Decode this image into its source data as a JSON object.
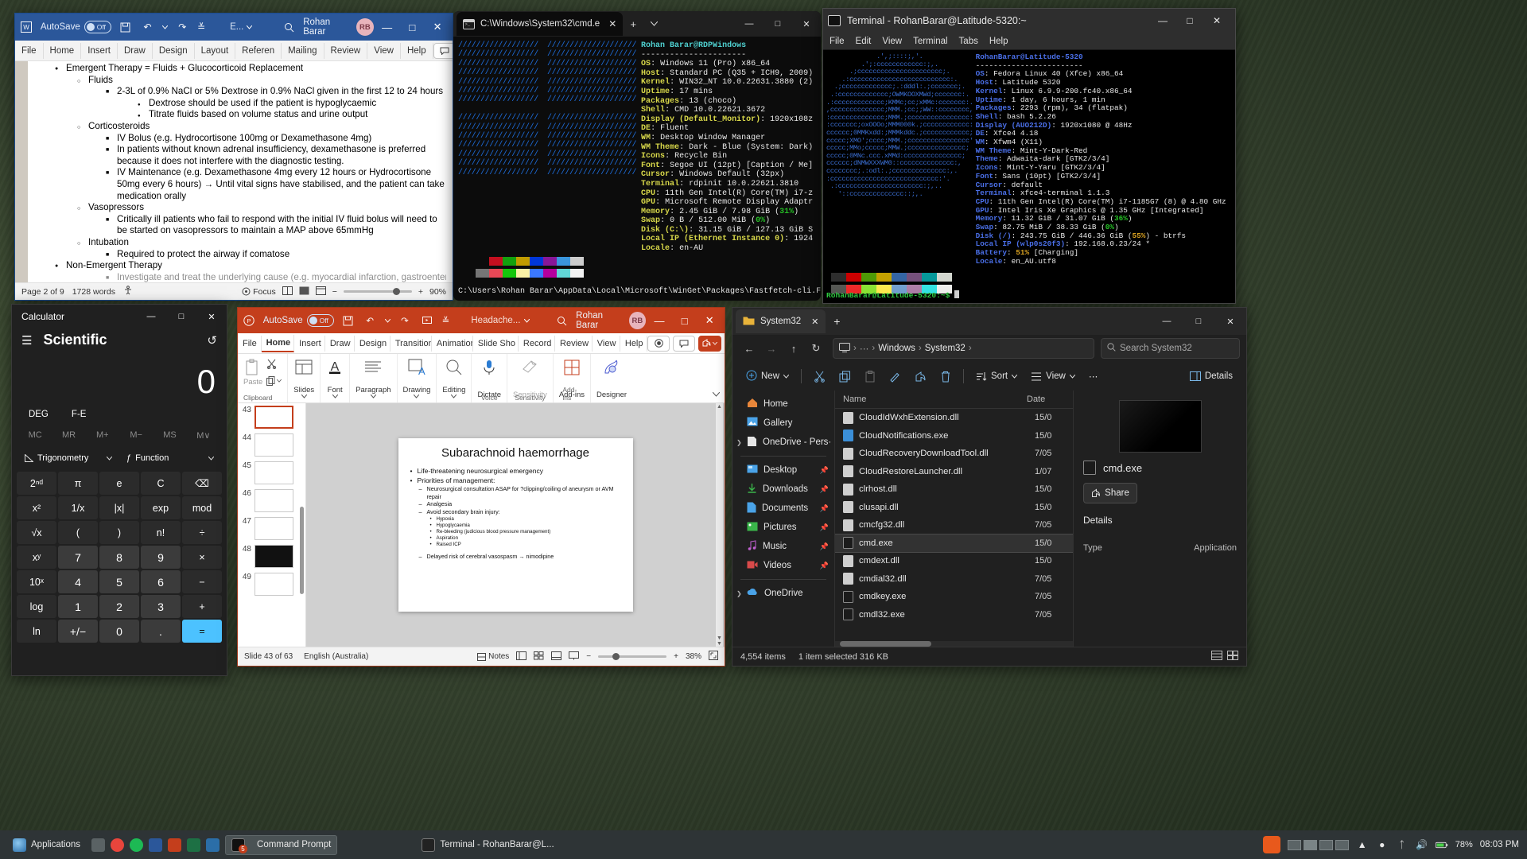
{
  "word": {
    "title_autosave": "AutoSave",
    "autosave_state": "Off",
    "filename_short": "E...",
    "user": "Rohan Barar",
    "avatar_initials": "RB",
    "tabs": [
      "File",
      "Home",
      "Insert",
      "Draw",
      "Design",
      "Layout",
      "Referen",
      "Mailing",
      "Review",
      "View",
      "Help"
    ],
    "document_lines": [
      {
        "level": 1,
        "text": "Emergent Therapy = Fluids + Glucocorticoid Replacement"
      },
      {
        "level": 2,
        "text": "Fluids"
      },
      {
        "level": 3,
        "text": "2-3L of 0.9% NaCl or 5% Dextrose in 0.9% NaCl given in the first 12 to 24 hours"
      },
      {
        "level": 4,
        "text": "Dextrose should be used if the patient is hypoglycaemic"
      },
      {
        "level": 4,
        "text": "Titrate fluids based on volume status and urine output"
      },
      {
        "level": 2,
        "text": "Corticosteroids"
      },
      {
        "level": 3,
        "text": "IV Bolus (e.g. Hydrocortisone 100mg or Dexamethasone 4mg)"
      },
      {
        "level": 3,
        "text": "In patients without known adrenal insufficiency, dexamethasone is preferred because it does not interfere with the diagnostic testing."
      },
      {
        "level": 3,
        "text": "IV Maintenance (e.g. Dexamethasone 4mg every 12 hours or Hydrocortisone 50mg every 6 hours) → Until vital signs have stabilised, and the patient can take medication orally"
      },
      {
        "level": 2,
        "text": "Vasopressors"
      },
      {
        "level": 3,
        "text": "Critically ill patients who fail to respond with the initial IV fluid bolus will need to be started on vasopressors to maintain a MAP above 65mmHg"
      },
      {
        "level": 2,
        "text": "Intubation"
      },
      {
        "level": 3,
        "text": "Required to protect the airway if comatose"
      },
      {
        "level": 1,
        "text": "Non-Emergent Therapy"
      },
      {
        "level": 3,
        "text": "Investigate and treat the underlying cause (e.g. myocardial infarction, gastroenteritis, acute"
      }
    ],
    "status": {
      "page": "Page 2 of 9",
      "words": "1728 words",
      "focus": "Focus",
      "zoom": "90%"
    }
  },
  "cmd": {
    "tab_title": "C:\\Windows\\System32\\cmd.e",
    "fastfetch": {
      "header": "Rohan Barar@RDPWindows",
      "divider": "----------------------",
      "rows": [
        {
          "k": "OS",
          "v": "Windows 11 (Pro) x86_64"
        },
        {
          "k": "Host",
          "v": "Standard PC (Q35 + ICH9, 2009)"
        },
        {
          "k": "Kernel",
          "v": "WIN32_NT 10.0.22631.3880 (2)"
        },
        {
          "k": "Uptime",
          "v": "17 mins"
        },
        {
          "k": "Packages",
          "v": "13 (choco)"
        },
        {
          "k": "Shell",
          "v": "CMD 10.0.22621.3672"
        },
        {
          "k": "Display (Default_Monitor)",
          "v": "1920x108z"
        },
        {
          "k": "DE",
          "v": "Fluent"
        },
        {
          "k": "WM",
          "v": "Desktop Window Manager"
        },
        {
          "k": "WM Theme",
          "v": "Dark - Blue (System: Dark)"
        },
        {
          "k": "Icons",
          "v": "Recycle Bin"
        },
        {
          "k": "Font",
          "v": "Segoe UI (12pt) [Caption / Me]"
        },
        {
          "k": "Cursor",
          "v": "Windows Default (32px)"
        },
        {
          "k": "Terminal",
          "v": "rdpinit 10.0.22621.3810"
        },
        {
          "k": "CPU",
          "v": "11th Gen Intel(R) Core(TM) i7-z"
        },
        {
          "k": "GPU",
          "v": "Microsoft Remote Display Adaptr"
        },
        {
          "k": "Memory",
          "v": "2.45 GiB / 7.98 GiB (31%)",
          "pct": "31%",
          "pct_color": "green"
        },
        {
          "k": "Swap",
          "v": "0 B / 512.00 MiB (0%)",
          "pct": "0%",
          "pct_color": "green"
        },
        {
          "k": "Disk (C:\\)",
          "v": "31.15 GiB / 127.13 GiB S"
        },
        {
          "k": "Local IP (Ethernet Instance 0)",
          "v": "1924"
        },
        {
          "k": "Locale",
          "v": "en-AU"
        }
      ]
    },
    "prompt": "C:\\Users\\Rohan Barar\\AppData\\Local\\Microsoft\\WinGet\\Packages\\Fastfetch-cli.F"
  },
  "linux": {
    "title": "Terminal - RohanBarar@Latitude-5320:~",
    "menu": [
      "File",
      "Edit",
      "View",
      "Terminal",
      "Tabs",
      "Help"
    ],
    "fastfetch": {
      "header": "RohanBarar@Latitude-5320",
      "divider": "------------------------",
      "rows": [
        {
          "k": "OS",
          "v": "Fedora Linux 40 (Xfce) x86_64"
        },
        {
          "k": "Host",
          "v": "Latitude 5320"
        },
        {
          "k": "Kernel",
          "v": "Linux 6.9.9-200.fc40.x86_64"
        },
        {
          "k": "Uptime",
          "v": "1 day, 6 hours, 1 min"
        },
        {
          "k": "Packages",
          "v": "2293 (rpm), 34 (flatpak)"
        },
        {
          "k": "Shell",
          "v": "bash 5.2.26"
        },
        {
          "k": "Display (AUO212D)",
          "v": "1920x1080 @ 48Hz"
        },
        {
          "k": "DE",
          "v": "Xfce4 4.18"
        },
        {
          "k": "WM",
          "v": "Xfwm4 (X11)"
        },
        {
          "k": "WM Theme",
          "v": "Mint-Y-Dark-Red"
        },
        {
          "k": "Theme",
          "v": "Adwaita-dark [GTK2/3/4]"
        },
        {
          "k": "Icons",
          "v": "Mint-Y-Yaru [GTK2/3/4]"
        },
        {
          "k": "Font",
          "v": "Sans (10pt) [GTK2/3/4]"
        },
        {
          "k": "Cursor",
          "v": "default"
        },
        {
          "k": "Terminal",
          "v": "xfce4-terminal 1.1.3"
        },
        {
          "k": "CPU",
          "v": "11th Gen Intel(R) Core(TM) i7-1185G7 (8) @ 4.80 GHz"
        },
        {
          "k": "GPU",
          "v": "Intel Iris Xe Graphics @ 1.35 GHz [Integrated]"
        },
        {
          "k": "Memory",
          "v": "11.32 GiB / 31.07 GiB (36%)",
          "pct": "36%",
          "pct_color": "green"
        },
        {
          "k": "Swap",
          "v": "82.75 MiB / 38.33 GiB (0%)",
          "pct": "0%",
          "pct_color": "green"
        },
        {
          "k": "Disk (/)",
          "v": "243.75 GiB / 446.36 GiB (55%) - btrfs",
          "pct": "55%",
          "pct_color": "orange"
        },
        {
          "k": "Local IP (wlp0s20f3)",
          "v": "192.168.0.23/24 *"
        },
        {
          "k": "Battery",
          "v": "51% [Charging]",
          "pct": "51%",
          "pct_color": "orange"
        },
        {
          "k": "Locale",
          "v": "en_AU.utf8"
        }
      ]
    },
    "prompt": "RohanBarar@Latitude-5320:~$"
  },
  "calculator": {
    "title": "Calculator",
    "mode": "Scientific",
    "display": "0",
    "angle_mode": "DEG",
    "fe_mode": "F-E",
    "memory": [
      "MC",
      "MR",
      "M+",
      "M−",
      "MS",
      "M∨"
    ],
    "dropdowns": [
      "Trigonometry",
      "Function"
    ],
    "keys": [
      "2ⁿᵈ",
      "π",
      "e",
      "C",
      "⌫",
      "x²",
      "1/x",
      "|x|",
      "exp",
      "mod",
      "√x",
      "(",
      ")",
      "n!",
      "÷",
      "xʸ",
      "7",
      "8",
      "9",
      "×",
      "10ˣ",
      "4",
      "5",
      "6",
      "−",
      "log",
      "1",
      "2",
      "3",
      "+",
      "ln",
      "+/−",
      "0",
      ".",
      "="
    ]
  },
  "powerpoint": {
    "autosave": "AutoSave",
    "autosave_state": "Off",
    "filename_short": "Headache...",
    "user": "Rohan Barar",
    "avatar_initials": "RB",
    "tabs": [
      "File",
      "Home",
      "Insert",
      "Draw",
      "Design",
      "Transition",
      "Animation",
      "Slide Sho",
      "Record",
      "Review",
      "View",
      "Help"
    ],
    "ribbon_groups": [
      {
        "label": "Paste",
        "group": "Clipboard"
      },
      {
        "label": "Slides",
        "group": ""
      },
      {
        "label": "Font",
        "group": ""
      },
      {
        "label": "Paragraph",
        "group": ""
      },
      {
        "label": "Drawing",
        "group": ""
      },
      {
        "label": "Editing",
        "group": ""
      },
      {
        "label": "Dictate",
        "group": "Voice"
      },
      {
        "label": "Sensitivity",
        "group": "Sensitivity"
      },
      {
        "label": "Add-ins",
        "group": "Add-ins"
      },
      {
        "label": "Designer",
        "group": ""
      }
    ],
    "thumbnails": [
      "43",
      "44",
      "45",
      "46",
      "47",
      "48",
      "49"
    ],
    "selected_thumb": "43",
    "slide": {
      "title": "Subarachnoid haemorrhage",
      "bullets": [
        {
          "level": 1,
          "text": "Life-threatening neurosurgical emergency"
        },
        {
          "level": 1,
          "text": "Priorities of management:"
        },
        {
          "level": 2,
          "text": "Neurosurgical consultation ASAP for ?clipping/coiling of aneurysm or AVM repair"
        },
        {
          "level": 2,
          "text": "Analgesia"
        },
        {
          "level": 2,
          "text": "Avoid secondary brain injury:"
        },
        {
          "level": 3,
          "text": "Hypoxia"
        },
        {
          "level": 3,
          "text": "Hypoglycaemia"
        },
        {
          "level": 3,
          "text": "Re-bleeding (judicious blood pressure management)"
        },
        {
          "level": 3,
          "text": "Aspiration"
        },
        {
          "level": 3,
          "text": "Raised ICP"
        },
        {
          "level": 2,
          "text": "Delayed risk of cerebral vasospasm → nimodipine",
          "link": "nimodipine"
        }
      ]
    },
    "status": {
      "slide_counter": "Slide 43 of 63",
      "language": "English (Australia)",
      "notes": "Notes",
      "zoom": "38%"
    }
  },
  "explorer": {
    "tab_title": "System32",
    "breadcrumbs": [
      "Windows",
      "System32"
    ],
    "search_placeholder": "Search System32",
    "commands": [
      "New",
      "Sort",
      "View",
      "Details"
    ],
    "sidebar": [
      {
        "label": "Home",
        "icon": "home-icon",
        "pin": false
      },
      {
        "label": "Gallery",
        "icon": "gallery-icon",
        "pin": false
      },
      {
        "label": "OneDrive - Pers·",
        "icon": "onedrive-icon",
        "pin": false,
        "chevron": true
      },
      {
        "label": "Desktop",
        "icon": "desktop-icon",
        "pin": true
      },
      {
        "label": "Downloads",
        "icon": "downloads-icon",
        "pin": true
      },
      {
        "label": "Documents",
        "icon": "documents-icon",
        "pin": true
      },
      {
        "label": "Pictures",
        "icon": "pictures-icon",
        "pin": true
      },
      {
        "label": "Music",
        "icon": "music-icon",
        "pin": true
      },
      {
        "label": "Videos",
        "icon": "videos-icon",
        "pin": true
      },
      {
        "label": "OneDrive",
        "icon": "onedrive-icon",
        "pin": false,
        "chevron": true
      }
    ],
    "columns": [
      "Name",
      "Date"
    ],
    "files": [
      {
        "name": "CloudIdWxhExtension.dll",
        "date": "15/0",
        "type": "dll"
      },
      {
        "name": "CloudNotifications.exe",
        "date": "15/0",
        "type": "exe"
      },
      {
        "name": "CloudRecoveryDownloadTool.dll",
        "date": "7/05",
        "type": "dll"
      },
      {
        "name": "CloudRestoreLauncher.dll",
        "date": "1/07",
        "type": "dll"
      },
      {
        "name": "clrhost.dll",
        "date": "15/0",
        "type": "dll"
      },
      {
        "name": "clusapi.dll",
        "date": "15/0",
        "type": "dll"
      },
      {
        "name": "cmcfg32.dll",
        "date": "7/05",
        "type": "dll"
      },
      {
        "name": "cmd.exe",
        "date": "15/0",
        "type": "exe2",
        "selected": true
      },
      {
        "name": "cmdext.dll",
        "date": "15/0",
        "type": "dll"
      },
      {
        "name": "cmdial32.dll",
        "date": "7/05",
        "type": "dll"
      },
      {
        "name": "cmdkey.exe",
        "date": "7/05",
        "type": "exe2"
      },
      {
        "name": "cmdl32.exe",
        "date": "7/05",
        "type": "exe2"
      }
    ],
    "preview": {
      "name": "cmd.exe",
      "share_label": "Share",
      "details_header": "Details",
      "detail_rows": [
        {
          "k": "Type",
          "v": "Application"
        }
      ]
    },
    "status": {
      "items": "4,554 items",
      "selection": "1 item selected  316 KB"
    }
  },
  "taskbar": {
    "applications": "Applications",
    "buttons": [
      {
        "label": "Command Prompt",
        "badge": "5",
        "active": true
      },
      {
        "label": "Terminal - RohanBarar@L...",
        "active": false
      }
    ],
    "clock": "08:03 PM",
    "battery": "78%"
  }
}
